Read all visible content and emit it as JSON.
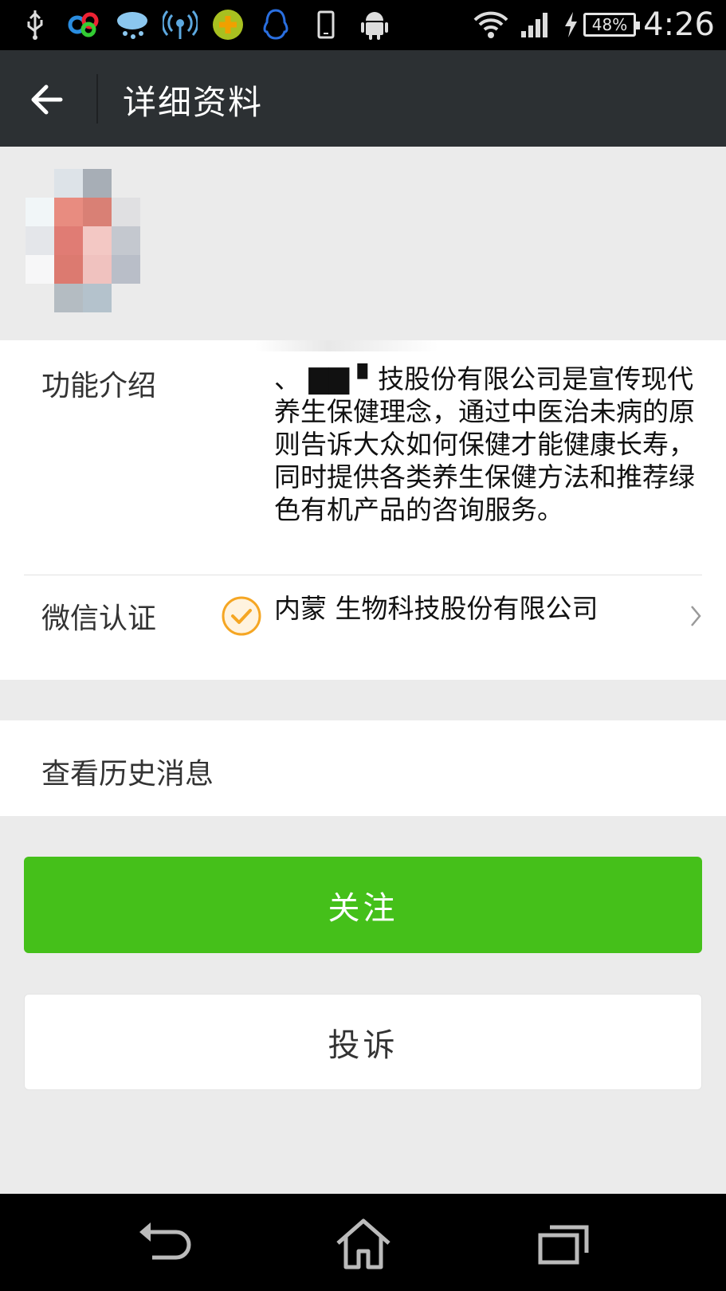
{
  "status_bar": {
    "time": "4:26",
    "battery": "48%",
    "icons": [
      "usb-icon",
      "app-icon",
      "weather-icon",
      "hotspot-icon",
      "360-icon",
      "qq-icon",
      "phone-icon",
      "android-icon",
      "wifi-icon",
      "signal-icon",
      "charging-icon"
    ]
  },
  "action_bar": {
    "title": "详细资料",
    "back_icon": "arrow-left-icon"
  },
  "profile": {
    "intro_label": "功能介绍",
    "intro_text": "、  ▇▇    ▘技股份有限公司是宣传现代养生保健理念，通过中医治未病的原则告诉大众如何保健才能健康长寿，同时提供各类养生保健方法和推荐绿色有机产品的咨询服务。",
    "verify_label": "微信认证",
    "verify_text": "内蒙        生物科技股份有限公司",
    "verify_icon": "check-badge-icon",
    "chevron_icon": "chevron-right-icon"
  },
  "history": {
    "label": "查看历史消息"
  },
  "buttons": {
    "follow": "关注",
    "report": "投诉",
    "follow_color": "#45c01a"
  },
  "nav": {
    "icons": [
      "back-icon",
      "home-icon",
      "recents-icon"
    ]
  }
}
